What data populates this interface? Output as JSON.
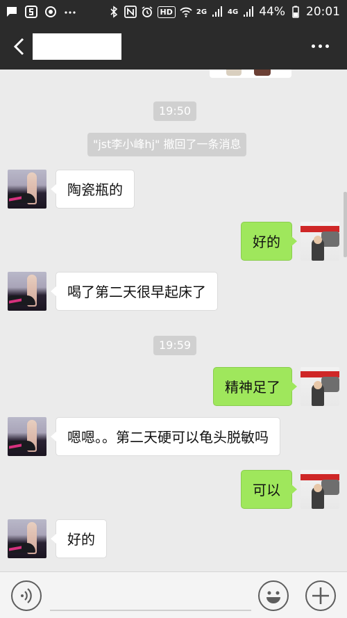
{
  "status_bar": {
    "hd_label": "HD",
    "net1": "2G",
    "net2": "4G",
    "battery": "44%",
    "time": "20:01",
    "icons": [
      "message-icon",
      "s-app-icon",
      "sync-icon",
      "more-dots-icon",
      "bluetooth-icon",
      "nfc-icon",
      "alarm-icon",
      "wifi-icon",
      "signal-icon",
      "battery-icon"
    ]
  },
  "header": {
    "title": "",
    "back_icon": "back-arrow-icon",
    "menu_icon": "more-options-icon"
  },
  "chat": {
    "timestamps": [
      "19:50",
      "19:59"
    ],
    "recall_notice": "\"jst李小峰hj\" 撤回了一条消息",
    "messages": [
      {
        "side": "in",
        "text": "陶瓷瓶的"
      },
      {
        "side": "out",
        "text": "好的"
      },
      {
        "side": "in",
        "text": "喝了第二天很早起床了"
      },
      {
        "side": "out",
        "text": "精神足了"
      },
      {
        "side": "in",
        "text": "嗯嗯。。第二天硬可以龟头脱敏吗"
      },
      {
        "side": "out",
        "text": "可以"
      },
      {
        "side": "in",
        "text": "好的"
      }
    ]
  },
  "input_bar": {
    "placeholder": "",
    "icons": [
      "voice-icon",
      "emoji-icon",
      "plus-icon"
    ]
  },
  "colors": {
    "bar_bg": "#2b2b2b",
    "chat_bg": "#ebebeb",
    "outgoing_bubble": "#9fe75c",
    "incoming_bubble": "#ffffff"
  }
}
